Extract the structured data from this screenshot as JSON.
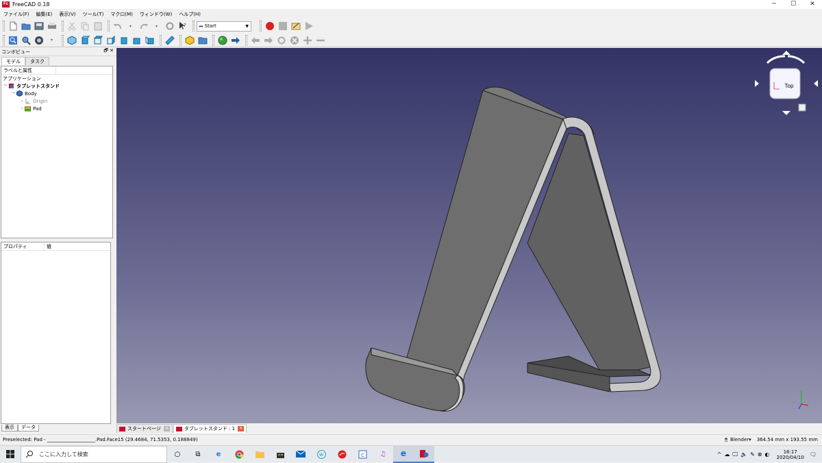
{
  "window": {
    "title": "FreeCAD 0.18",
    "controls": [
      "─",
      "☐",
      "✕"
    ]
  },
  "menu": [
    "ファイル(F)",
    "編集(E)",
    "表示(V)",
    "ツール(T)",
    "マクロ(M)",
    "ウィンドウ(W)",
    "ヘルプ(H)"
  ],
  "toolbar": {
    "workbench": "Start"
  },
  "combo": {
    "title": "コンボビュー",
    "header_buttons": "🗗 ✕",
    "tabs": [
      "モデル",
      "タスク"
    ],
    "tree_header": "ラベルと属性",
    "tree": {
      "section": "アプリケーション",
      "document": "タブレットスタンド",
      "body": "Body",
      "origin": "Origin",
      "pad": "Pad"
    },
    "prop_headers": [
      "プロパティ",
      "値"
    ],
    "bottom_tabs": [
      "表示",
      "データ"
    ]
  },
  "navcube": {
    "face": "Top"
  },
  "doc_tabs": [
    {
      "label": "スタートページ",
      "active": false
    },
    {
      "label": "タブレットスタンド : 1",
      "active": true
    }
  ],
  "status": {
    "message": "Preselected: Pad - ____________________.Pad.Face15 (29.4684, 71.5353, 0.188849)",
    "nav_style": "Blender",
    "dimensions": "364.54 mm x 193.55 mm"
  },
  "taskbar": {
    "search_placeholder": "ここに入力して検索",
    "time": "16:17",
    "date": "2020/04/10"
  },
  "colors": {
    "viewport_top": "#333366",
    "viewport_bottom": "#9999b3",
    "model_face": "#6e6e6e",
    "model_edge": "#c8c8c8"
  }
}
